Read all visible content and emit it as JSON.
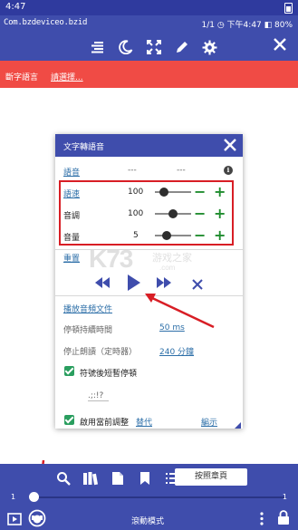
{
  "status_bar": {
    "time": "4:47"
  },
  "app_bar": {
    "package": "Com.bzdeviceo.bzid",
    "status_right": "1/1 ◷ 下午4:47 ◧ 80%",
    "tools": [
      "align-icon",
      "moon-icon",
      "fullscreen-icon",
      "pencil-icon",
      "gear-icon"
    ],
    "close_icon": "close-icon"
  },
  "red_bar": {
    "label": "斷字語言",
    "select": "請選擇..."
  },
  "dialog": {
    "title": "文字轉語音",
    "voice": {
      "label": "語音",
      "value1": "---",
      "value2": "---"
    },
    "speed": {
      "label": "語速",
      "value": "100",
      "level": 0.15
    },
    "pitch": {
      "label": "音調",
      "value": "100",
      "level": 0.5
    },
    "volume": {
      "label": "音量",
      "value": "5",
      "level": 0.25
    },
    "reset": "重置",
    "play_file": "播放音頻文件",
    "pause_duration": {
      "label": "停頓持續時間",
      "value": "50 ms"
    },
    "stop_reading": {
      "label": "停止朗讀（定時器）",
      "value": "240 分鐘"
    },
    "pause_after_symbol": {
      "label": "符號後短暫停頓",
      "checked": true
    },
    "symbols": ".;:!?",
    "replace": {
      "label": "啟用當前調整",
      "link": "替代",
      "right": "編示",
      "checked": true
    }
  },
  "watermark": {
    "main": "K73",
    "cn": "游戏之家",
    "domain": ".com"
  },
  "bottom_bar": {
    "icons": [
      "search-icon",
      "books-icon",
      "file-icon",
      "bookmark-icon",
      "list-icon"
    ],
    "page_button": "按照章頁",
    "page_left": "1",
    "page_right": "1",
    "progress": 0.0,
    "scroll_mode": "滾動模式"
  },
  "colors": {
    "primary": "#3f4dac",
    "accent_red": "#f04b45",
    "highlight_box": "#d81e25",
    "green": "#1f8c2e",
    "link": "#2d6fa8"
  }
}
